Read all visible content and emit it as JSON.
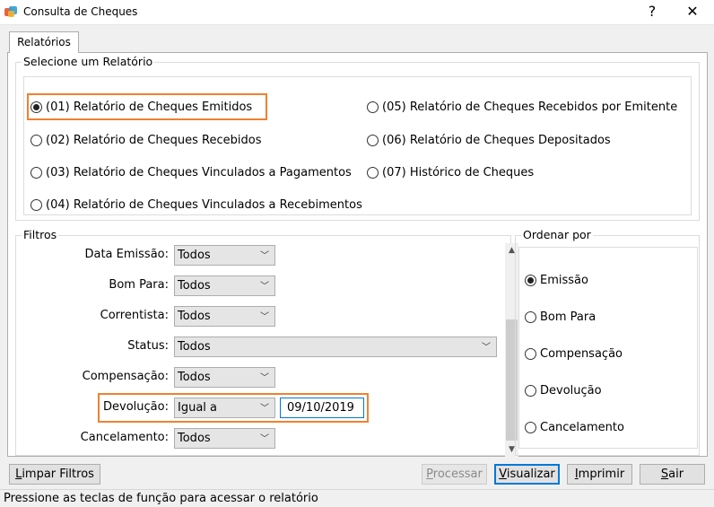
{
  "window": {
    "title": "Consulta de Cheques",
    "help": "?",
    "close": "✕"
  },
  "tab": {
    "label": "Relatórios"
  },
  "reports": {
    "legend": "Selecione um Relatório",
    "options": [
      {
        "label": "(01) Relatório de Cheques Emitidos",
        "checked": true
      },
      {
        "label": "(02) Relatório de Cheques Recebidos",
        "checked": false
      },
      {
        "label": "(03) Relatório de Cheques Vinculados a Pagamentos",
        "checked": false
      },
      {
        "label": "(04) Relatório de Cheques Vinculados a Recebimentos",
        "checked": false
      },
      {
        "label": "(05) Relatório de Cheques Recebidos por Emitente",
        "checked": false
      },
      {
        "label": "(06) Relatório de Cheques Depositados",
        "checked": false
      },
      {
        "label": "(07) Histórico de Cheques",
        "checked": false
      }
    ]
  },
  "filters": {
    "legend": "Filtros",
    "rows": [
      {
        "label": "Data Emissão:",
        "value": "Todos"
      },
      {
        "label": "Bom Para:",
        "value": "Todos"
      },
      {
        "label": "Correntista:",
        "value": "Todos"
      },
      {
        "label": "Status:",
        "value": "Todos"
      },
      {
        "label": "Compensação:",
        "value": "Todos"
      },
      {
        "label": "Devolução:",
        "value": "Igual a",
        "date": "09/10/2019"
      },
      {
        "label": "Cancelamento:",
        "value": "Todos"
      }
    ]
  },
  "order": {
    "legend": "Ordenar por",
    "options": [
      {
        "label": "Emissão",
        "checked": true
      },
      {
        "label": "Bom Para",
        "checked": false
      },
      {
        "label": "Compensação",
        "checked": false
      },
      {
        "label": "Devolução",
        "checked": false
      },
      {
        "label": "Cancelamento",
        "checked": false
      }
    ]
  },
  "buttons": {
    "limpar": {
      "mnemonic": "L",
      "rest": "impar Filtros"
    },
    "processar": {
      "mnemonic": "P",
      "rest": "rocessar",
      "enabled": false
    },
    "visualizar": {
      "mnemonic": "V",
      "rest": "isualizar"
    },
    "imprimir": {
      "mnemonic": "I",
      "rest": "mprimir"
    },
    "sair": {
      "mnemonic": "S",
      "rest": "air"
    }
  },
  "status": {
    "text": "Pressione as teclas de função para acessar o relatório"
  },
  "colors": {
    "highlight": "#f0812f",
    "focus": "#0078d7"
  }
}
